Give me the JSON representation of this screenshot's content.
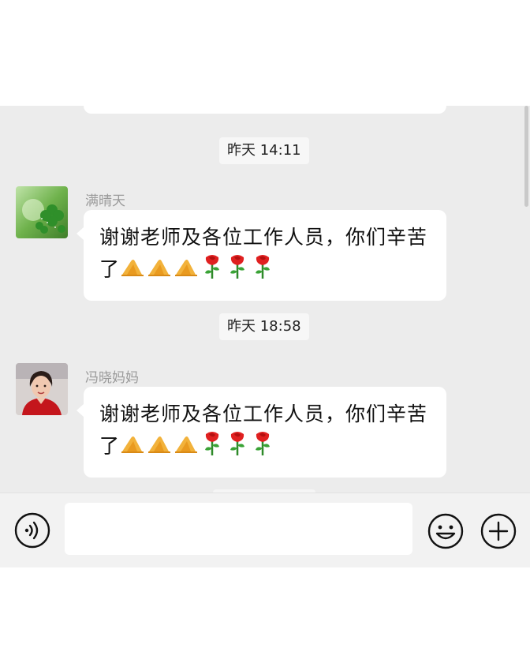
{
  "messages": [
    {
      "timestamp": "昨天 14:11",
      "sender": "满晴天",
      "text": "谢谢老师及各位工作人员，你们辛苦了",
      "emojis": [
        "folded-hands",
        "folded-hands",
        "folded-hands",
        "rose",
        "rose",
        "rose"
      ]
    },
    {
      "timestamp": "昨天 18:58",
      "sender": "冯晓妈妈",
      "text": "谢谢老师及各位工作人员，你们辛苦了",
      "emojis": [
        "folded-hands",
        "folded-hands",
        "folded-hands",
        "rose",
        "rose",
        "rose"
      ]
    }
  ],
  "input_bar": {
    "placeholder": "",
    "icons": [
      "voice-icon",
      "emoji-face-icon",
      "plus-icon"
    ]
  },
  "colors": {
    "chat_background": "#ececec",
    "bubble": "#ffffff",
    "timestamp_bg": "#f7f7f7",
    "input_bar": "#f2f2f2"
  }
}
